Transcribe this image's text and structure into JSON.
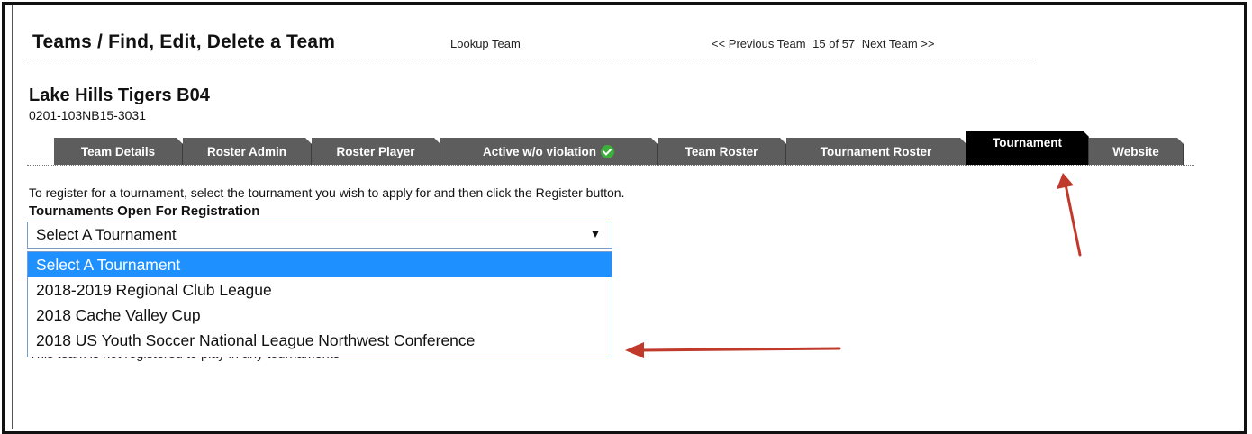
{
  "header": {
    "title": "Teams / Find, Edit, Delete a Team",
    "lookup_label": "Lookup Team",
    "prev_label": "<< Previous Team",
    "position_label": "15 of 57",
    "next_label": "Next Team >>"
  },
  "team": {
    "name": "Lake Hills Tigers B04",
    "code": "0201-103NB15-3031"
  },
  "tabs": [
    {
      "label": "Team Details"
    },
    {
      "label": "Roster Admin"
    },
    {
      "label": "Roster Player"
    },
    {
      "label": "Active w/o violation",
      "icon": "check-circle-icon"
    },
    {
      "label": "Team Roster"
    },
    {
      "label": "Tournament Roster"
    },
    {
      "label": "Tournament",
      "active": true
    },
    {
      "label": "Website"
    }
  ],
  "main": {
    "instructions": "To register for a tournament, select the tournament you wish to apply for and then click the Register button.",
    "open_label": "Tournaments Open For Registration",
    "select_value": "Select A Tournament",
    "options": [
      "Select A Tournament",
      "2018-2019 Regional Club League",
      "2018 Cache Valley Cup",
      "2018 US Youth Soccer National League Northwest Conference"
    ],
    "not_registered": "This team is not registered to play in any tournaments"
  },
  "colors": {
    "tab_bg": "#5d5d5d",
    "tab_active_bg": "#000000",
    "selected_option": "#1e90ff",
    "annotation_arrow": "#c0392b",
    "check": "#3cae3c"
  }
}
